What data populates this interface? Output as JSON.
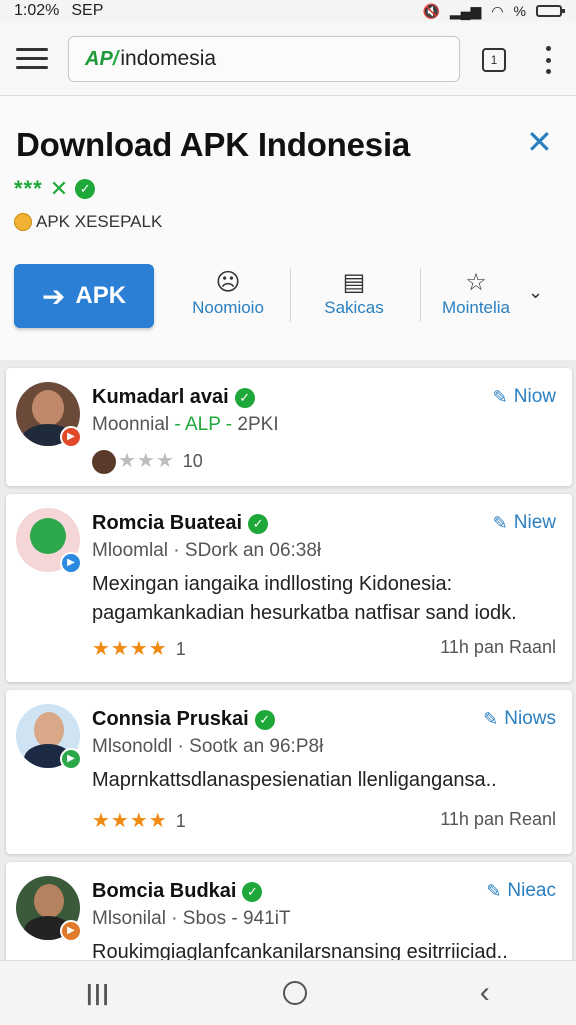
{
  "status": {
    "time": "1:02%",
    "carrier": "SEP",
    "signal_icon": "signal-icon",
    "wifi_icon": "wifi-icon",
    "battery_label": "%"
  },
  "browser": {
    "logo_text": "AP",
    "url": "indomesia",
    "tabs_count": "1"
  },
  "header": {
    "title": "Download APK Indonesia",
    "rating": "*** ✕",
    "subtitle": "APK XESEPALK",
    "apk_button": "APK",
    "actions": [
      {
        "label": "Noomioio",
        "icon": "face-icon"
      },
      {
        "label": "Sakicas",
        "icon": "message-icon"
      },
      {
        "label": "Mointelia",
        "icon": "star-outline-icon"
      }
    ]
  },
  "cards": [
    {
      "name": "Kumadarl avai",
      "meta_a": "Moonnial",
      "meta_b": "- ALP -",
      "meta_c": "2PKI",
      "new_label": "Niow",
      "rating_count": "10"
    },
    {
      "name": "Romcia Buateai",
      "meta": "Mloomlal · SDork  an 06:38ł",
      "new_label": "Niew",
      "body": "Mexingan iangaika indllosting Kidonesia: pagamkankadian hesurkatba natfisar sand iodk.",
      "stars": "★★★★",
      "count": "1",
      "time": "11h pan Raanl"
    },
    {
      "name": "Connsia Pruskai",
      "meta": "Mlsonoldl · Sootk  an 96:P8ł",
      "new_label": "Niows",
      "body": "Maprnkattsdlanaspesienatian llenligangansa..",
      "stars": "★★★★",
      "count": "1",
      "time": "11h pan Reanl"
    },
    {
      "name": "Bomcia Budkai",
      "meta": "Mlsonilal · Sbos - 941iT",
      "new_label": "Nieac",
      "body": "Roukimgiaglanfcankanilarsnansing esitrriiciad.."
    }
  ],
  "colors": {
    "accent": "#2a7fc0",
    "button": "#2b7fd4",
    "green": "#1fa83a",
    "star": "#f08a12"
  }
}
